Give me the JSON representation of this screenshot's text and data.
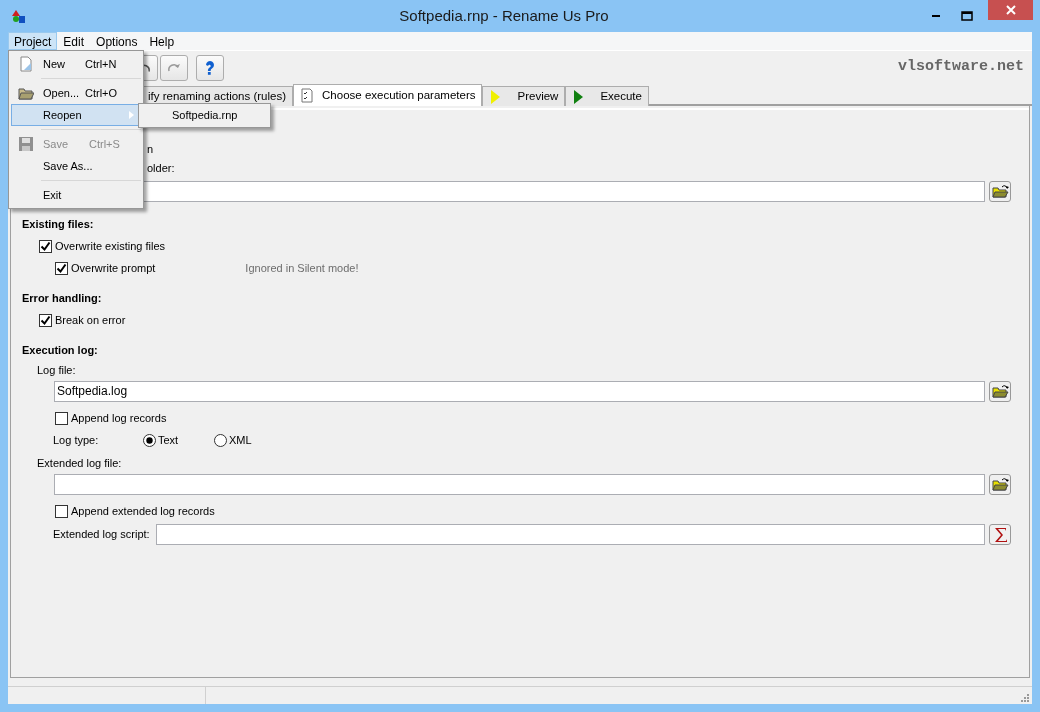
{
  "window": {
    "title": "Softpedia.rnp - Rename Us Pro"
  },
  "menu_bar": [
    {
      "label": "Project",
      "selected": true
    },
    {
      "label": "Edit",
      "selected": false
    },
    {
      "label": "Options",
      "selected": false
    },
    {
      "label": "Help",
      "selected": false
    }
  ],
  "project_menu": [
    {
      "kind": "item",
      "label": "New",
      "shortcut": "Ctrl+N",
      "disabled": false,
      "selected": false
    },
    {
      "kind": "separator"
    },
    {
      "kind": "item",
      "label": "Open...",
      "shortcut": "Ctrl+O",
      "disabled": false,
      "selected": false
    },
    {
      "kind": "submenu",
      "label": "Reopen",
      "selected": true,
      "children": [
        {
          "label": "Softpedia.rnp"
        }
      ]
    },
    {
      "kind": "separator"
    },
    {
      "kind": "item",
      "label": "Save",
      "shortcut": "Ctrl+S",
      "disabled": true,
      "selected": false
    },
    {
      "kind": "item",
      "label": "Save As...",
      "disabled": false,
      "selected": false
    },
    {
      "kind": "separator"
    },
    {
      "kind": "item",
      "label": "Exit",
      "disabled": false,
      "selected": false
    }
  ],
  "toolbar": {
    "buttons": [
      {
        "kind": "undo"
      },
      {
        "kind": "redo"
      },
      {
        "kind": "help"
      }
    ],
    "logo_text": "vlsoftware.net"
  },
  "tabs": [
    {
      "label": "ify renaming actions (rules)",
      "selected": false,
      "kind": "plain"
    },
    {
      "label": "Choose execution parameters",
      "selected": true,
      "kind": "checklist"
    },
    {
      "label": "Preview",
      "selected": false,
      "kind": "yellow-play"
    },
    {
      "label": "Execute",
      "selected": false,
      "kind": "green-play"
    }
  ],
  "top_area": {
    "lines": [
      "n",
      "older:"
    ],
    "field": {
      "kind": "field"
    }
  },
  "sections": [
    {
      "heading": "Existing files:",
      "items": [
        {
          "kind": "checkbox",
          "label": "Overwrite existing files",
          "checked": true,
          "children": [
            {
              "kind": "checkbox",
              "label": "Overwrite prompt",
              "checked": true,
              "note": "Ignored in Silent mode!"
            }
          ]
        }
      ]
    },
    {
      "heading": "Error handling:",
      "items": [
        {
          "kind": "checkbox",
          "label": "Break on error",
          "checked": true
        }
      ]
    },
    {
      "heading": "Execution log:",
      "items": [
        {
          "kind": "label",
          "label": "Log file:",
          "children": [
            {
              "kind": "field",
              "value": "Softpedia.log"
            },
            {
              "kind": "checkbox",
              "label": "Append log records",
              "checked": false
            },
            {
              "kind": "radio",
              "label": "Log type:",
              "options": [
                {
                  "label": "Text",
                  "selected": true
                },
                {
                  "label": "XML",
                  "selected": false
                }
              ]
            }
          ]
        },
        {
          "kind": "label",
          "label": "Extended log file:",
          "children": [
            {
              "kind": "field"
            },
            {
              "kind": "checkbox",
              "label": "Append extended log records",
              "checked": false
            },
            {
              "kind": "labeled-field",
              "label": "Extended log script:"
            }
          ]
        }
      ]
    }
  ]
}
